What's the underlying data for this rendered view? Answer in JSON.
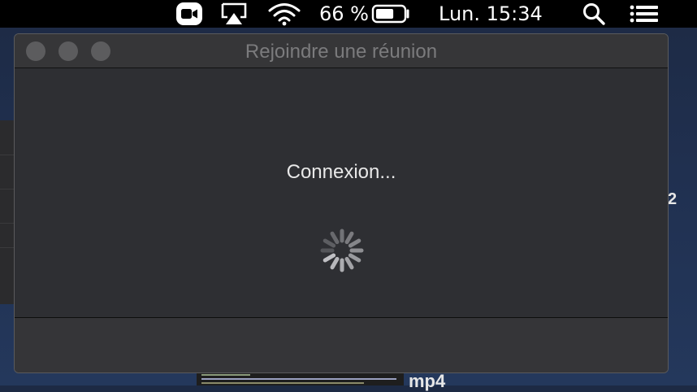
{
  "menubar": {
    "battery_percent": "66 %",
    "battery_level": 0.66,
    "clock": "Lun. 15:34",
    "icons": [
      "zoom-icon",
      "airplay-icon",
      "wifi-icon",
      "battery-icon",
      "spotlight-search-icon",
      "notification-center-icon"
    ]
  },
  "window": {
    "title": "Rejoindre une réunion",
    "status": "Connexion..."
  },
  "background": {
    "right_digit": "2",
    "bottom_text": "mp4"
  },
  "colors": {
    "menubar": "#000000",
    "window_bg": "#2e2f33",
    "text": "#e8e8e8"
  }
}
